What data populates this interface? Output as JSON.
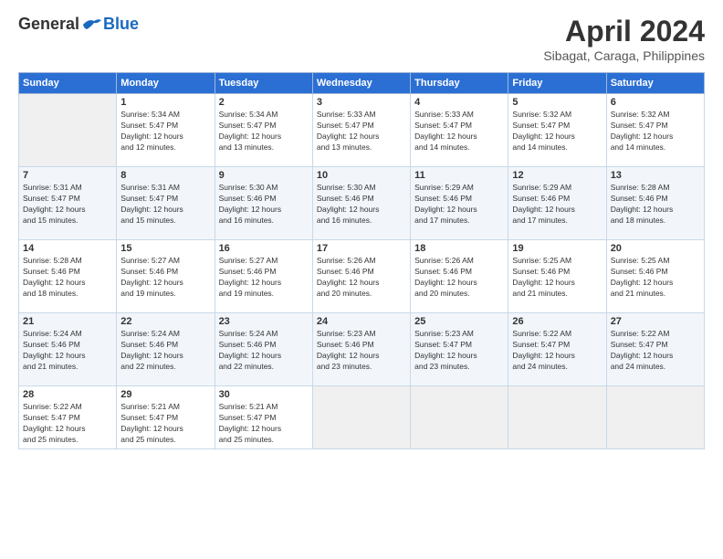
{
  "header": {
    "logo_general": "General",
    "logo_blue": "Blue",
    "month_title": "April 2024",
    "location": "Sibagat, Caraga, Philippines"
  },
  "calendar": {
    "days_of_week": [
      "Sunday",
      "Monday",
      "Tuesday",
      "Wednesday",
      "Thursday",
      "Friday",
      "Saturday"
    ],
    "weeks": [
      [
        {
          "day": "",
          "info": ""
        },
        {
          "day": "1",
          "info": "Sunrise: 5:34 AM\nSunset: 5:47 PM\nDaylight: 12 hours\nand 12 minutes."
        },
        {
          "day": "2",
          "info": "Sunrise: 5:34 AM\nSunset: 5:47 PM\nDaylight: 12 hours\nand 13 minutes."
        },
        {
          "day": "3",
          "info": "Sunrise: 5:33 AM\nSunset: 5:47 PM\nDaylight: 12 hours\nand 13 minutes."
        },
        {
          "day": "4",
          "info": "Sunrise: 5:33 AM\nSunset: 5:47 PM\nDaylight: 12 hours\nand 14 minutes."
        },
        {
          "day": "5",
          "info": "Sunrise: 5:32 AM\nSunset: 5:47 PM\nDaylight: 12 hours\nand 14 minutes."
        },
        {
          "day": "6",
          "info": "Sunrise: 5:32 AM\nSunset: 5:47 PM\nDaylight: 12 hours\nand 14 minutes."
        }
      ],
      [
        {
          "day": "7",
          "info": "Sunrise: 5:31 AM\nSunset: 5:47 PM\nDaylight: 12 hours\nand 15 minutes."
        },
        {
          "day": "8",
          "info": "Sunrise: 5:31 AM\nSunset: 5:47 PM\nDaylight: 12 hours\nand 15 minutes."
        },
        {
          "day": "9",
          "info": "Sunrise: 5:30 AM\nSunset: 5:46 PM\nDaylight: 12 hours\nand 16 minutes."
        },
        {
          "day": "10",
          "info": "Sunrise: 5:30 AM\nSunset: 5:46 PM\nDaylight: 12 hours\nand 16 minutes."
        },
        {
          "day": "11",
          "info": "Sunrise: 5:29 AM\nSunset: 5:46 PM\nDaylight: 12 hours\nand 17 minutes."
        },
        {
          "day": "12",
          "info": "Sunrise: 5:29 AM\nSunset: 5:46 PM\nDaylight: 12 hours\nand 17 minutes."
        },
        {
          "day": "13",
          "info": "Sunrise: 5:28 AM\nSunset: 5:46 PM\nDaylight: 12 hours\nand 18 minutes."
        }
      ],
      [
        {
          "day": "14",
          "info": "Sunrise: 5:28 AM\nSunset: 5:46 PM\nDaylight: 12 hours\nand 18 minutes."
        },
        {
          "day": "15",
          "info": "Sunrise: 5:27 AM\nSunset: 5:46 PM\nDaylight: 12 hours\nand 19 minutes."
        },
        {
          "day": "16",
          "info": "Sunrise: 5:27 AM\nSunset: 5:46 PM\nDaylight: 12 hours\nand 19 minutes."
        },
        {
          "day": "17",
          "info": "Sunrise: 5:26 AM\nSunset: 5:46 PM\nDaylight: 12 hours\nand 20 minutes."
        },
        {
          "day": "18",
          "info": "Sunrise: 5:26 AM\nSunset: 5:46 PM\nDaylight: 12 hours\nand 20 minutes."
        },
        {
          "day": "19",
          "info": "Sunrise: 5:25 AM\nSunset: 5:46 PM\nDaylight: 12 hours\nand 21 minutes."
        },
        {
          "day": "20",
          "info": "Sunrise: 5:25 AM\nSunset: 5:46 PM\nDaylight: 12 hours\nand 21 minutes."
        }
      ],
      [
        {
          "day": "21",
          "info": "Sunrise: 5:24 AM\nSunset: 5:46 PM\nDaylight: 12 hours\nand 21 minutes."
        },
        {
          "day": "22",
          "info": "Sunrise: 5:24 AM\nSunset: 5:46 PM\nDaylight: 12 hours\nand 22 minutes."
        },
        {
          "day": "23",
          "info": "Sunrise: 5:24 AM\nSunset: 5:46 PM\nDaylight: 12 hours\nand 22 minutes."
        },
        {
          "day": "24",
          "info": "Sunrise: 5:23 AM\nSunset: 5:46 PM\nDaylight: 12 hours\nand 23 minutes."
        },
        {
          "day": "25",
          "info": "Sunrise: 5:23 AM\nSunset: 5:47 PM\nDaylight: 12 hours\nand 23 minutes."
        },
        {
          "day": "26",
          "info": "Sunrise: 5:22 AM\nSunset: 5:47 PM\nDaylight: 12 hours\nand 24 minutes."
        },
        {
          "day": "27",
          "info": "Sunrise: 5:22 AM\nSunset: 5:47 PM\nDaylight: 12 hours\nand 24 minutes."
        }
      ],
      [
        {
          "day": "28",
          "info": "Sunrise: 5:22 AM\nSunset: 5:47 PM\nDaylight: 12 hours\nand 25 minutes."
        },
        {
          "day": "29",
          "info": "Sunrise: 5:21 AM\nSunset: 5:47 PM\nDaylight: 12 hours\nand 25 minutes."
        },
        {
          "day": "30",
          "info": "Sunrise: 5:21 AM\nSunset: 5:47 PM\nDaylight: 12 hours\nand 25 minutes."
        },
        {
          "day": "",
          "info": ""
        },
        {
          "day": "",
          "info": ""
        },
        {
          "day": "",
          "info": ""
        },
        {
          "day": "",
          "info": ""
        }
      ]
    ]
  }
}
